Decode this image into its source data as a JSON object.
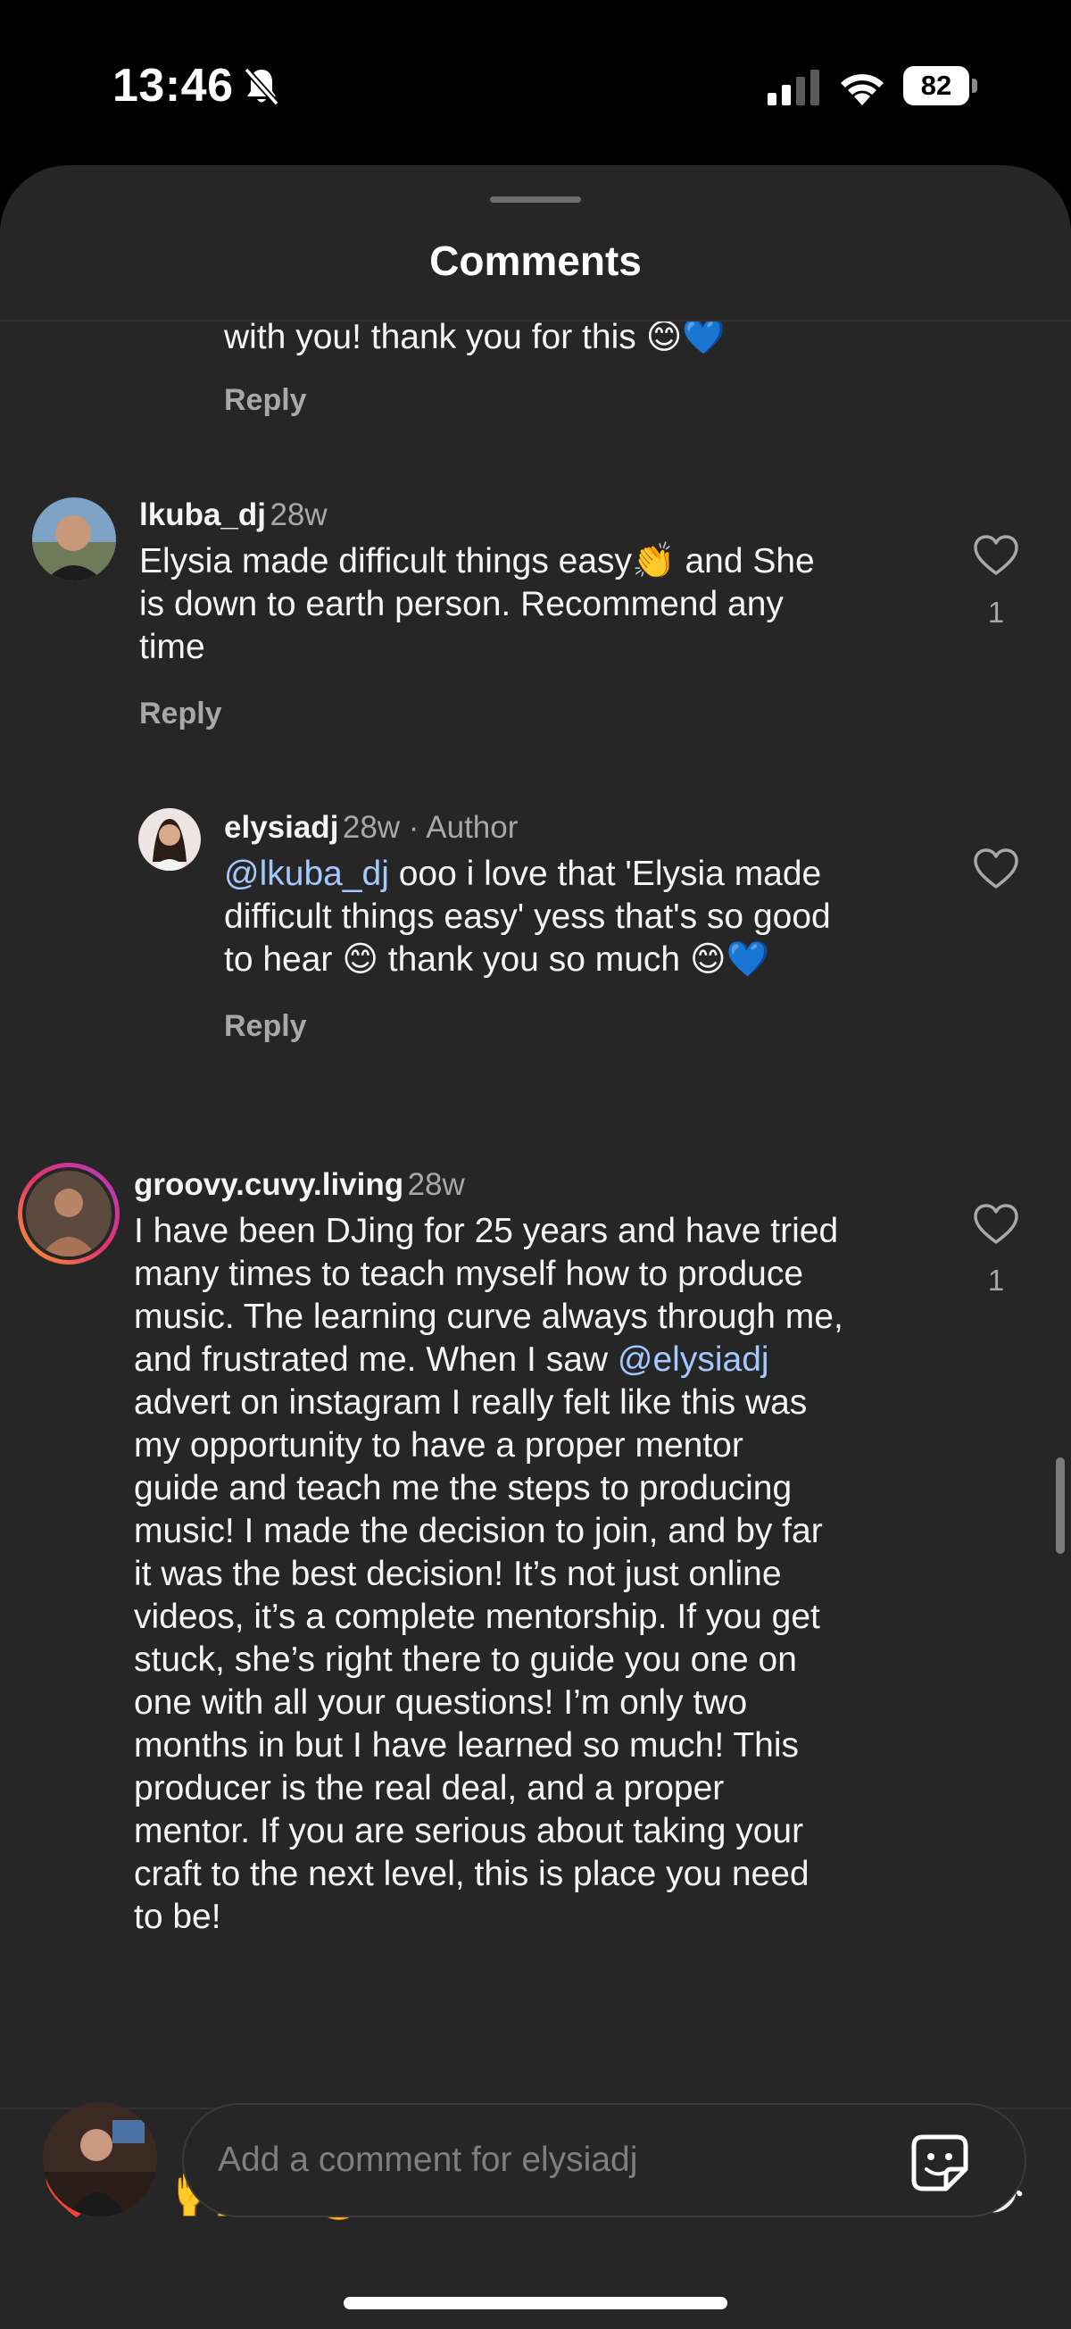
{
  "status_bar": {
    "time": "13:46",
    "battery": "82",
    "icons": [
      "bell-slash-icon",
      "cellular-signal-icon",
      "wifi-icon",
      "battery-icon"
    ]
  },
  "sheet": {
    "title": "Comments"
  },
  "comments": {
    "partial": {
      "text": "with you! thank you for this 😊💙",
      "reply_label": "Reply"
    },
    "lkuba": {
      "username": "lkuba_dj",
      "time": "28w",
      "line1": "Elysia made difficult things easy👏 and She",
      "line2": "is down to earth person. Recommend any",
      "line3": "time",
      "reply_label": "Reply",
      "likes": "1"
    },
    "elysia_reply": {
      "username": "elysiadj",
      "time": "28w · Author",
      "mention": "@lkuba_dj",
      "line1_rest": " ooo i love that 'Elysia made",
      "line2": "difficult things easy' yess that's so good",
      "line3": "to hear 😊 thank you so much 😊💙",
      "reply_label": "Reply"
    },
    "groovy": {
      "username": "groovy.cuvy.living",
      "time": "28w",
      "likes": "1",
      "line1": "I have been DJing for 25 years and have tried",
      "line2": "many times to teach myself how to produce",
      "line3": "music. The learning curve always through me,",
      "line4_pre": "and frustrated me. When I saw ",
      "line4_mention": "@elysiadj",
      "line5": "advert on instagram I really felt like this was",
      "line6": "my opportunity to have a proper mentor",
      "line7": "guide and teach me the steps to producing",
      "line8": "music! I made the decision to join, and by far",
      "line9": "it was the best decision! It’s not just online",
      "line10": "videos, it’s a complete mentorship. If you get",
      "line11": "stuck, she’s right there to guide you one on",
      "line12": "one with all your questions! I’m only two",
      "line13": "months in but I have learned so much! This",
      "line14": "producer is the real deal, and a proper",
      "line15": "mentor. If you are serious about taking your",
      "line16": "craft to the next level, this is place you need",
      "line17": "to be!"
    }
  },
  "reactions": [
    "❤️",
    "🙌",
    "🔥",
    "👏",
    "😢",
    "😍",
    "😮",
    "😂"
  ],
  "composer": {
    "placeholder": "Add a comment for elysiadj"
  }
}
